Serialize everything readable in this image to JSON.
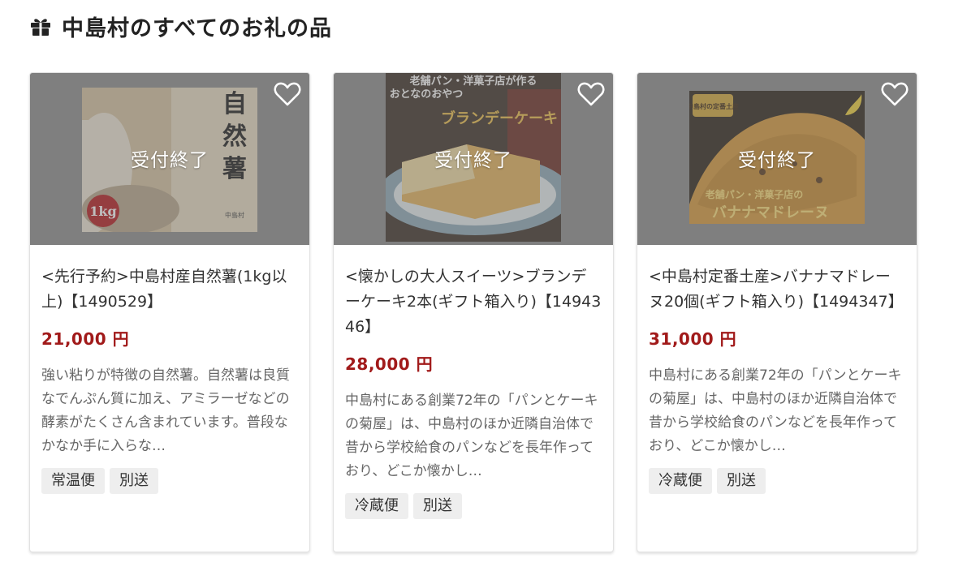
{
  "header": {
    "title": "中島村のすべてのお礼の品"
  },
  "icons": {
    "header": "gift-icon",
    "favorite": "heart-outline-icon"
  },
  "colors": {
    "price": "#a11a1a",
    "tag_bg": "#eeeeee",
    "overlay": "#8c8c8c"
  },
  "products": [
    {
      "status": "受付終了",
      "name": "<先行予約>中島村産自然薯(1kg以上)【1490529】",
      "price": "21,000 円",
      "description": "強い粘りが特徴の自然薯。自然薯は良質なでんぷん質に加え、アミラーゼなどの酵素がたくさん含まれています。普段なかなか手に入らな…",
      "tags": [
        "常温便",
        "別送"
      ],
      "image_text": {
        "title": "自然薯",
        "weight": "1kg",
        "origin": "中島村"
      }
    },
    {
      "status": "受付終了",
      "name": "<懐かしの大人スイーツ>ブランデーケーキ2本(ギフト箱入り)【1494346】",
      "price": "28,000 円",
      "description": "中島村にある創業72年の「パンとケーキの菊屋」は、中島村のほか近隣自治体で昔から学校給食のパンなどを長年作っており、どこか懐かし…",
      "tags": [
        "冷蔵便",
        "別送"
      ],
      "image_text": {
        "line1": "老舗パン・洋菓子店が作る",
        "line2": "おとなのおやつ",
        "line3": "ブランデーケーキ"
      }
    },
    {
      "status": "受付終了",
      "name": "<中島村定番土産>バナナマドレーヌ20個(ギフト箱入り)【1494347】",
      "price": "31,000 円",
      "description": "中島村にある創業72年の「パンとケーキの菊屋」は、中島村のほか近隣自治体で昔から学校給食のパンなどを長年作っており、どこか懐かし…",
      "tags": [
        "冷蔵便",
        "別送"
      ],
      "image_text": {
        "badge": "中島村の定番土産",
        "line1": "老舗パン・洋菓子店の",
        "line2": "バナナマドレーヌ"
      }
    }
  ]
}
